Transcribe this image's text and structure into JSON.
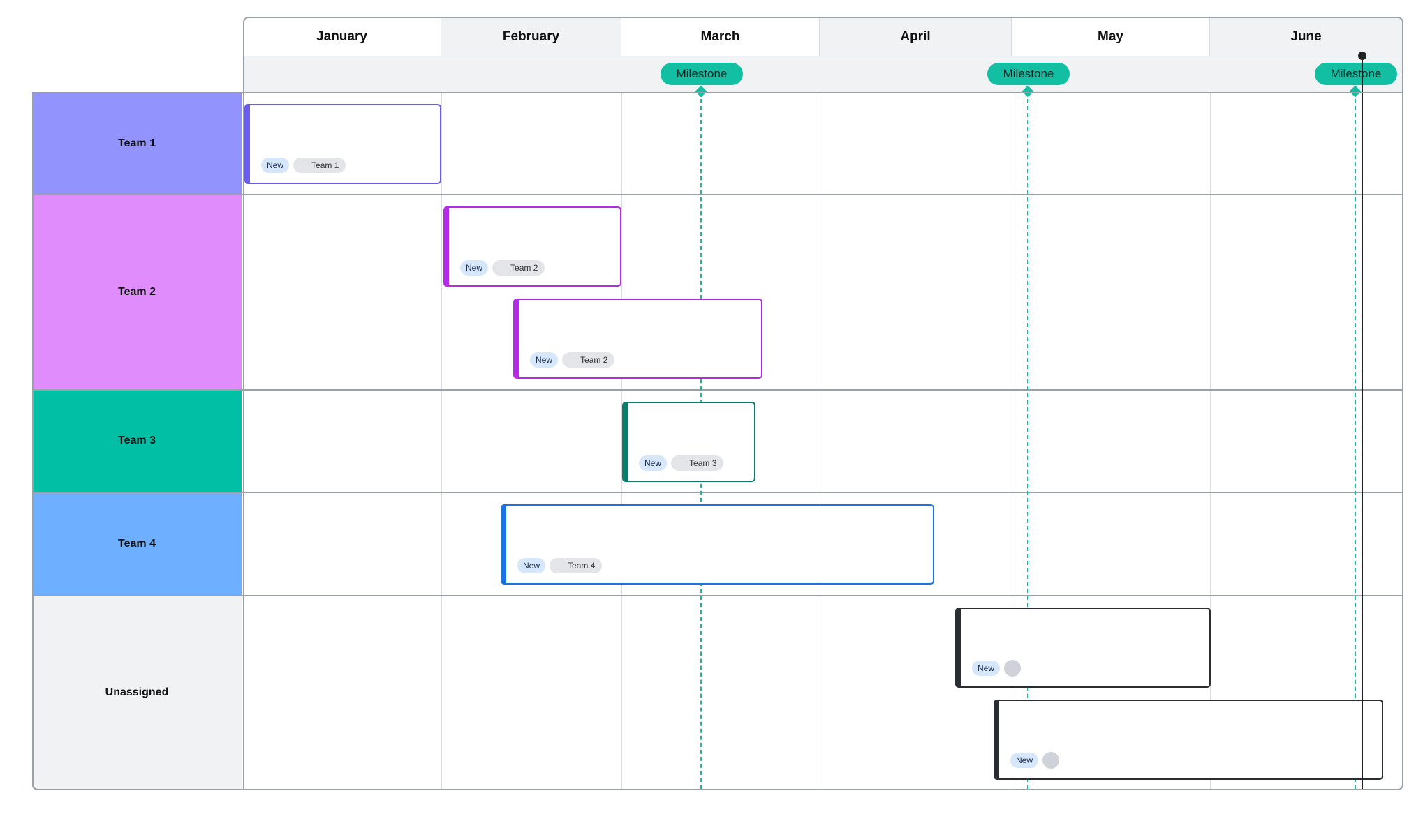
{
  "months": [
    "January",
    "February",
    "March",
    "April",
    "May",
    "June"
  ],
  "teams": [
    {
      "label": "Team 1",
      "color": "#9393fe"
    },
    {
      "label": "Team 2",
      "color": "#e08cfd"
    },
    {
      "label": "Team 3",
      "color": "#00bfa5"
    },
    {
      "label": "Team 4",
      "color": "#6eafff"
    },
    {
      "label": "Unassigned",
      "color": "#f1f2f4"
    }
  ],
  "tasks": [
    {
      "badge": "New",
      "team_tag": "Team 1",
      "border_color": "#6b5cf0"
    },
    {
      "badge": "New",
      "team_tag": "Team 2",
      "border_color": "#b42be6"
    },
    {
      "badge": "New",
      "team_tag": "Team 2",
      "border_color": "#b42be6"
    },
    {
      "badge": "New",
      "team_tag": "Team 3",
      "border_color": "#0b7e6b"
    },
    {
      "badge": "New",
      "team_tag": "Team 4",
      "border_color": "#1a73e0"
    },
    {
      "badge": "New",
      "team_tag": "",
      "border_color": "#2a2d33"
    },
    {
      "badge": "New",
      "team_tag": "",
      "border_color": "#2a2d33"
    }
  ],
  "milestones": [
    {
      "label": "Milestone"
    },
    {
      "label": "Milestone"
    },
    {
      "label": "Milestone"
    }
  ],
  "colors": {
    "milestone": "#13bfa3",
    "today_line": "#222222",
    "grid": "#d7dadf",
    "frame": "#9aa0a8"
  }
}
